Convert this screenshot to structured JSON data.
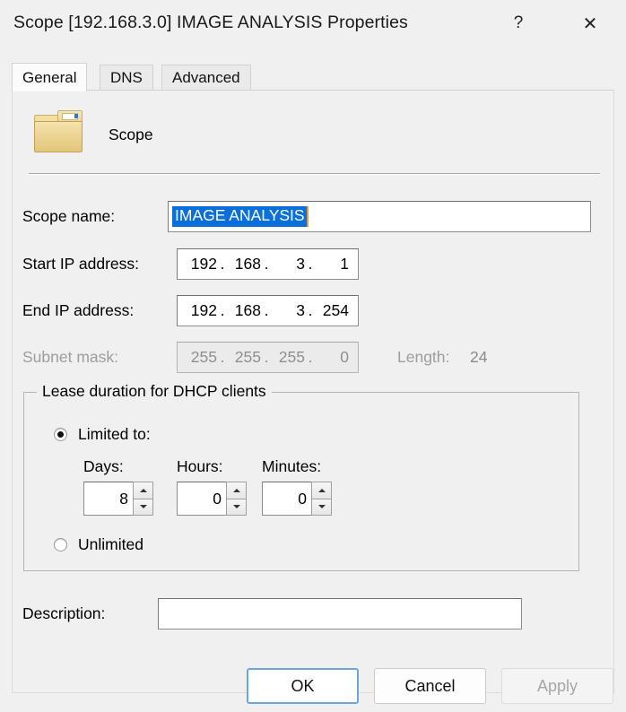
{
  "window": {
    "title": "Scope [192.168.3.0] IMAGE ANALYSIS Properties",
    "help_glyph": "?",
    "close_glyph": "✕"
  },
  "tabs": [
    {
      "id": "general",
      "label": "General",
      "selected": true
    },
    {
      "id": "dns",
      "label": "DNS",
      "selected": false
    },
    {
      "id": "advanced",
      "label": "Advanced",
      "selected": false
    }
  ],
  "header": {
    "icon": "folder-icon",
    "title": "Scope"
  },
  "fields": {
    "scope_name": {
      "label": "Scope name:",
      "value": "IMAGE ANALYSIS",
      "selected": true
    },
    "start_ip": {
      "label": "Start IP address:",
      "octets": [
        "192",
        "168",
        "3",
        "1"
      ],
      "separator": "."
    },
    "end_ip": {
      "label": "End IP address:",
      "octets": [
        "192",
        "168",
        "3",
        "254"
      ],
      "separator": "."
    },
    "subnet_mask": {
      "label": "Subnet mask:",
      "octets": [
        "255",
        "255",
        "255",
        "0"
      ],
      "separator": ".",
      "disabled": true
    },
    "length": {
      "label": "Length:",
      "value": "24"
    },
    "description": {
      "label": "Description:",
      "value": "",
      "placeholder": ""
    }
  },
  "lease_group": {
    "title": "Lease duration for DHCP clients",
    "limited_radio_label": "Limited to:",
    "unlimited_radio_label": "Unlimited",
    "selected_option": "limited",
    "days": {
      "label": "Days:",
      "value": "8"
    },
    "hours": {
      "label": "Hours:",
      "value": "0"
    },
    "minutes": {
      "label": "Minutes:",
      "value": "0"
    }
  },
  "buttons": {
    "ok": "OK",
    "cancel": "Cancel",
    "apply": "Apply"
  },
  "colors": {
    "dialog_bg": "#f0f0f0",
    "selection_blue": "#0a6fd8",
    "default_button_border": "#6ba6de",
    "disabled_text": "#9d9d9d"
  }
}
